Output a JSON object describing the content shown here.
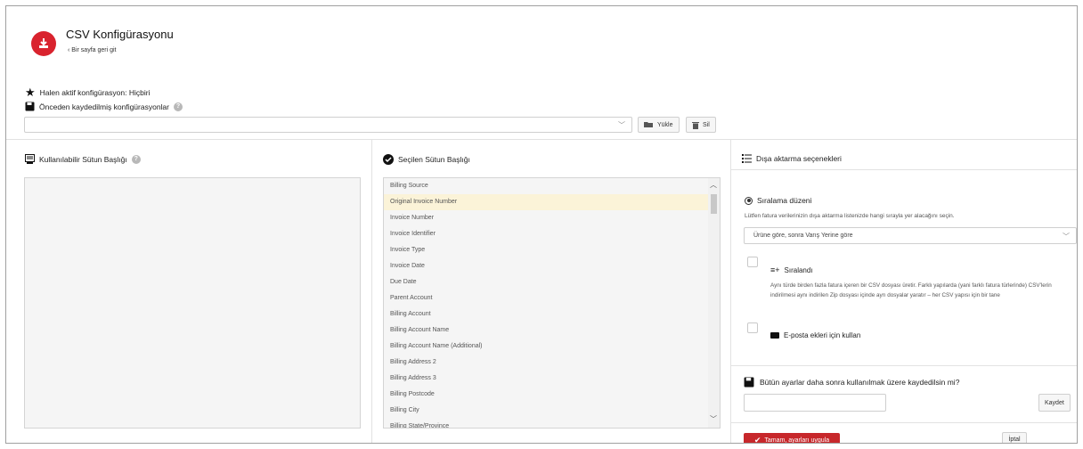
{
  "header": {
    "title": "CSV Konfigürasyonu",
    "back_link": "Bir sayfa geri git"
  },
  "config": {
    "active_label": "Halen aktif konfigürasyon: Hiçbiri",
    "saved_label": "Önceden kaydedilmiş konfigürasyonlar",
    "selected_value": "",
    "load_button": "Yükle",
    "delete_button": "Sil"
  },
  "available": {
    "title": "Kullanılabilir Sütun Başlığı"
  },
  "selected": {
    "title": "Seçilen Sütun Başlığı",
    "items": [
      "Billing Source",
      "Original Invoice Number",
      "Invoice Number",
      "Invoice Identifier",
      "Invoice Type",
      "Invoice Date",
      "Due Date",
      "Parent Account",
      "Billing Account",
      "Billing Account Name",
      "Billing Account Name (Additional)",
      "Billing Address 2",
      "Billing Address 3",
      "Billing Postcode",
      "Billing City",
      "Billing State/Province"
    ],
    "highlighted_index": 1
  },
  "export": {
    "title": "Dışa aktarma seçenekleri",
    "sort_title": "Sıralama düzeni",
    "sort_desc": "Lütfen fatura verilerinizin dışa aktarma listenizde hangi sırayla yer alacağını seçin.",
    "sort_value": "Ürüne göre, sonra Varış Yerine göre",
    "sorted_label": "Sıralandı",
    "sorted_desc": "Aynı türde birden fazla fatura içeren bir CSV dosyası üretir. Farklı yapılarda (yani farklı fatura türlerinde) CSV'lerin indirilmesi aynı indirilen Zip dosyası içinde ayrı dosyalar yaratır – her CSV yapısı için bir tane",
    "email_label": "E-posta ekleri için kullan"
  },
  "save": {
    "title": "Bütün ayarlar daha sonra kullanılmak üzere kaydedilsin mi?",
    "input_value": "",
    "save_button": "Kaydet"
  },
  "footer": {
    "ok_button": "Tamam, ayarları uygula",
    "cancel_button": "İptal"
  },
  "colors": {
    "accent": "#d9232e",
    "selected_row": "#fbf3d8"
  }
}
